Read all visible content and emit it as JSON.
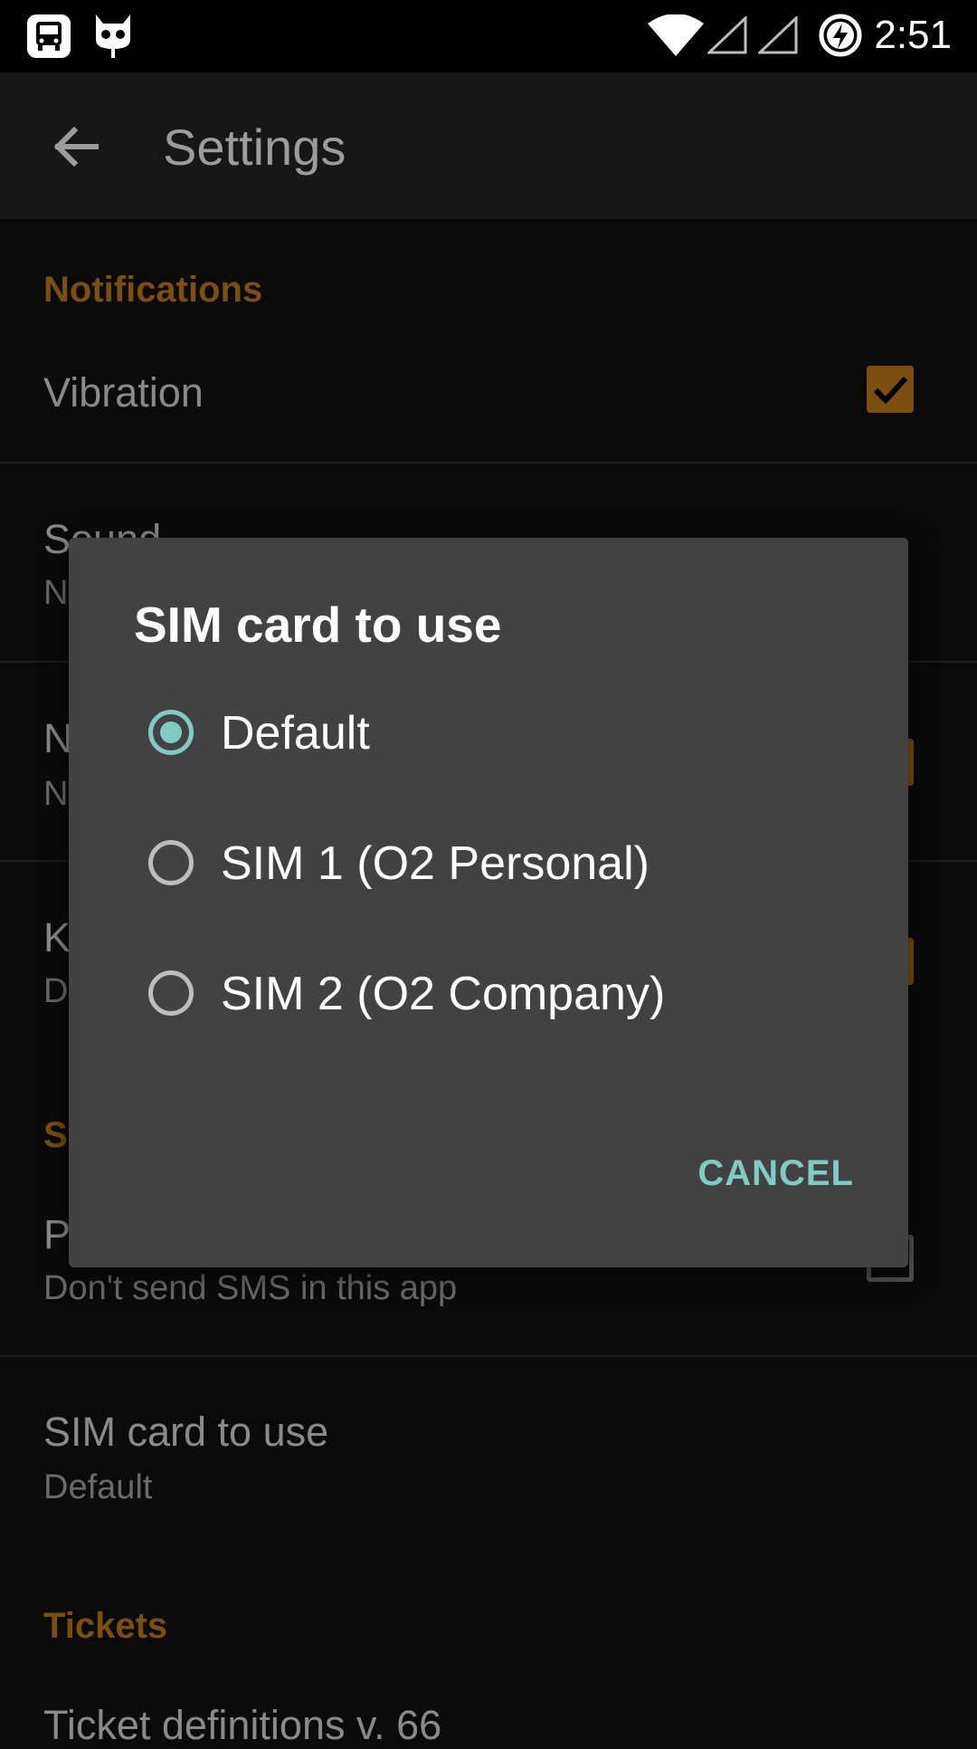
{
  "status_bar": {
    "time": "2:51",
    "icons": [
      "bus-app-icon",
      "cyanogen-icon",
      "wifi-icon",
      "signal-sim1-icon",
      "signal-sim2-icon",
      "battery-charging-icon"
    ]
  },
  "app_bar": {
    "title": "Settings",
    "back_icon": "arrow-back-icon"
  },
  "settings": {
    "notifications_header": "Notifications",
    "vibration": {
      "title": "Vibration",
      "checked": true
    },
    "sound": {
      "title": "Sound",
      "subtitle_partial": "N"
    },
    "item3": {
      "title_partial": "N",
      "subtitle_partial": "N",
      "checked": true
    },
    "item4": {
      "title_partial": "K",
      "subtitle_partial": "D",
      "checked": true
    },
    "section2_partial": "S",
    "item5": {
      "title_partial": "P",
      "subtitle": "Don't send SMS in this app",
      "checked": false
    },
    "sim_card": {
      "title": "SIM card to use",
      "subtitle": "Default"
    },
    "tickets_header": "Tickets",
    "ticket_definitions": "Ticket definitions v. 66"
  },
  "dialog": {
    "title": "SIM card to use",
    "options": [
      {
        "label": "Default",
        "selected": true
      },
      {
        "label": "SIM 1 (O2 Personal)",
        "selected": false
      },
      {
        "label": "SIM 2 (O2 Company)",
        "selected": false
      }
    ],
    "cancel_label": "CANCEL",
    "accent_color": "#80cbc4"
  }
}
